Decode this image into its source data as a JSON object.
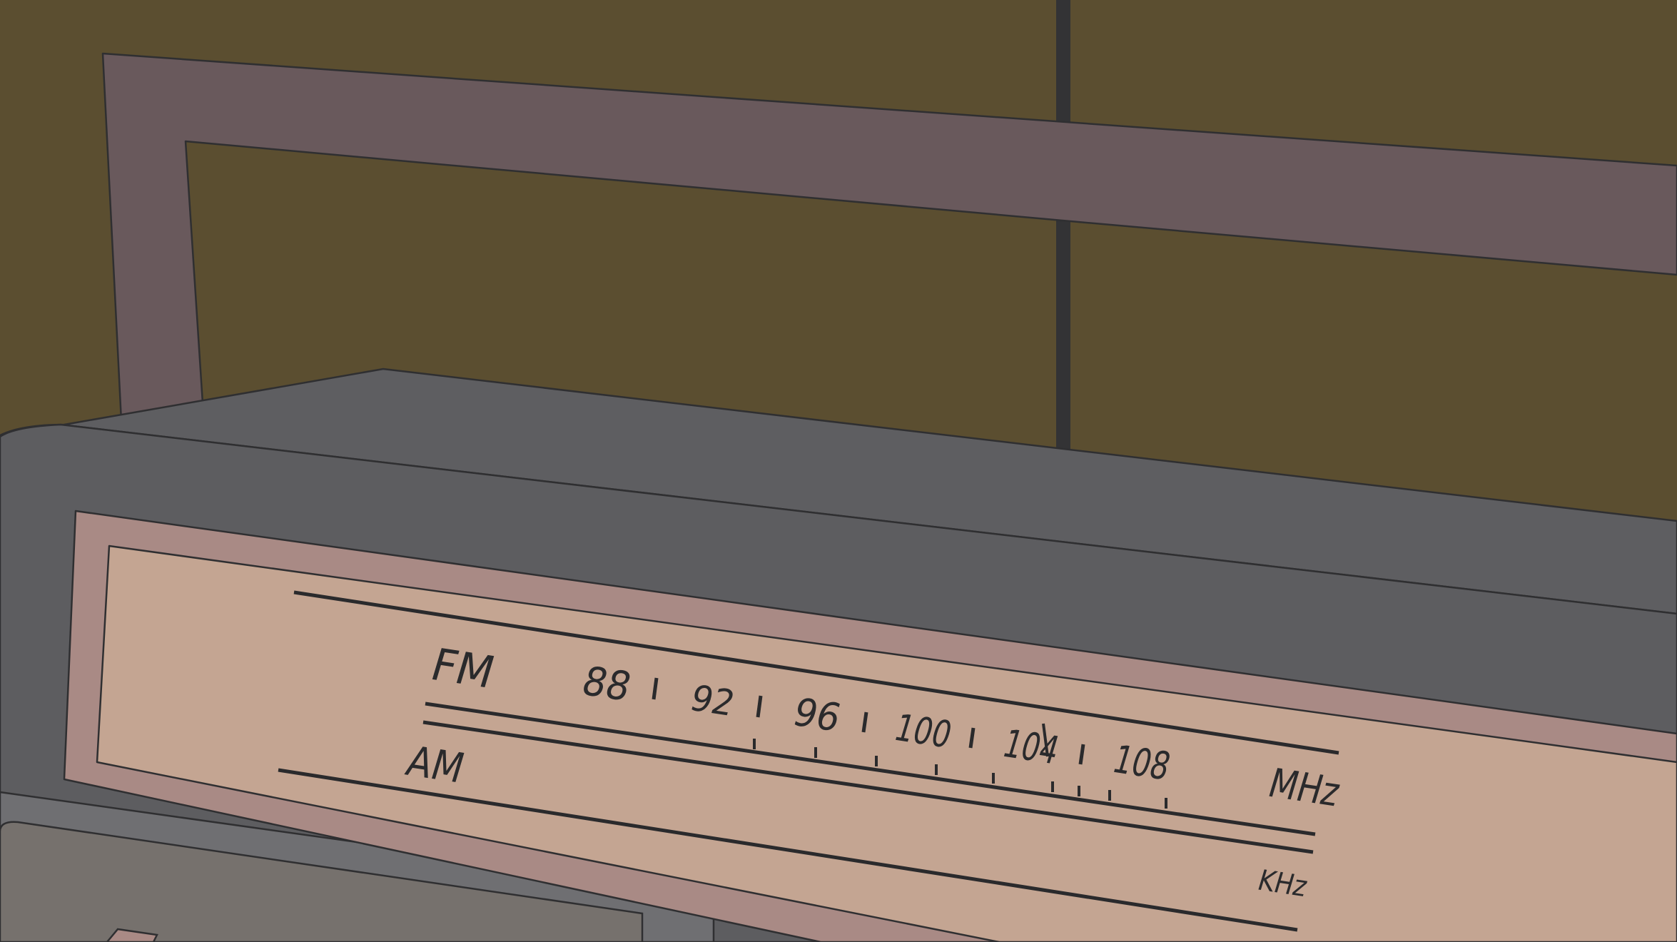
{
  "dial": {
    "fm_label": "FM",
    "am_label": "AM",
    "fm_unit": "MHz",
    "am_unit": "KHz",
    "frequencies": [
      "88",
      "92",
      "96",
      "100",
      "104",
      "108"
    ]
  },
  "colors": {
    "wall": "#5b4e30",
    "handle": "#69595c",
    "body_top": "#5e5e61",
    "body_front": "#5d5d60",
    "bezel": "#a98a85",
    "dial_face": "#c4a592",
    "ink": "#2a2a2c"
  }
}
